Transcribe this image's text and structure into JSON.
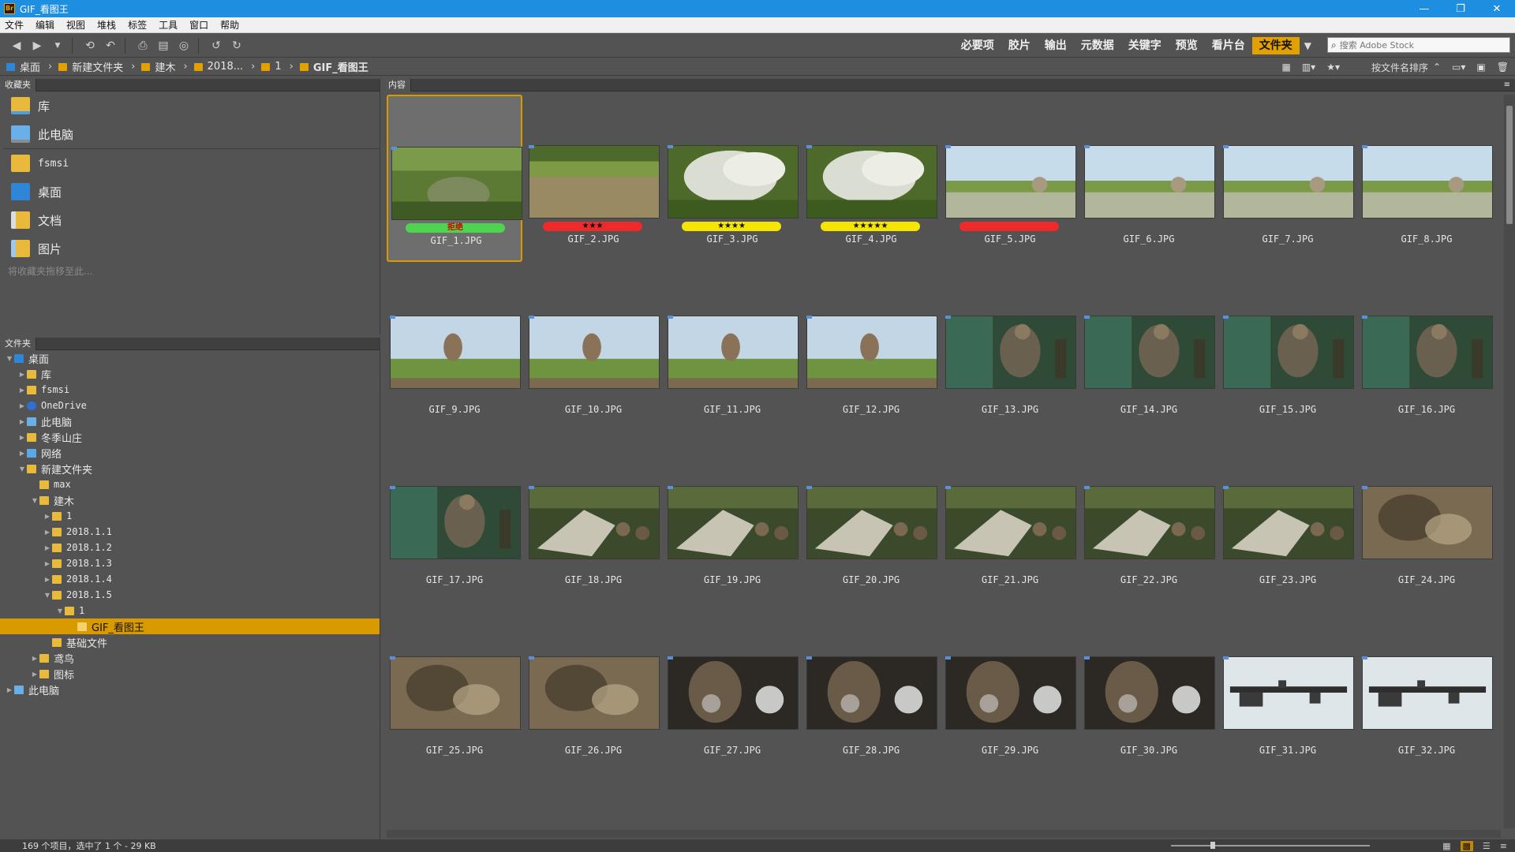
{
  "window": {
    "title": "GIF_看图王",
    "controls": [
      "—",
      "❐",
      "✕"
    ]
  },
  "menu": [
    "文件",
    "编辑",
    "视图",
    "堆栈",
    "标签",
    "工具",
    "窗口",
    "帮助"
  ],
  "toolbar": {
    "workspaces": [
      "必要项",
      "胶片",
      "输出",
      "元数据",
      "关键字",
      "预览",
      "看片台",
      "文件夹"
    ],
    "active_workspace": "文件夹",
    "search_placeholder": "搜索 Adobe Stock"
  },
  "breadcrumb": [
    "桌面",
    "新建文件夹",
    "建木",
    "2018...",
    "1",
    "GIF_看图王"
  ],
  "path_tools": {
    "sort_label": "按文件名排序"
  },
  "favorites": {
    "tab": "收藏夹",
    "items": [
      {
        "label": "库",
        "icon": "library-folder-icon"
      },
      {
        "label": "此电脑",
        "icon": "computer-icon"
      },
      {
        "label": "fsmsi",
        "icon": "user-folder-icon"
      },
      {
        "label": "桌面",
        "icon": "desktop-icon"
      },
      {
        "label": "文档",
        "icon": "documents-folder-icon"
      },
      {
        "label": "图片",
        "icon": "pictures-folder-icon"
      }
    ],
    "hint": "将收藏夹拖移至此..."
  },
  "folders": {
    "tab": "文件夹",
    "tree": [
      {
        "label": "桌面",
        "level": 0,
        "icon": "blue",
        "open": true
      },
      {
        "label": "库",
        "level": 1,
        "icon": "folder",
        "open": false
      },
      {
        "label": "fsmsi",
        "level": 1,
        "icon": "folder",
        "open": false
      },
      {
        "label": "OneDrive",
        "level": 1,
        "icon": "cloud",
        "open": false
      },
      {
        "label": "此电脑",
        "level": 1,
        "icon": "pc",
        "open": false
      },
      {
        "label": "冬季山庄",
        "level": 1,
        "icon": "folder",
        "open": false
      },
      {
        "label": "网络",
        "level": 1,
        "icon": "net",
        "open": false
      },
      {
        "label": "新建文件夹",
        "level": 1,
        "icon": "folder",
        "open": true
      },
      {
        "label": "max",
        "level": 2,
        "icon": "folder",
        "open": null
      },
      {
        "label": "建木",
        "level": 2,
        "icon": "folder",
        "open": true
      },
      {
        "label": "1",
        "level": 3,
        "icon": "folder",
        "open": false
      },
      {
        "label": "2018.1.1",
        "level": 3,
        "icon": "folder",
        "open": false
      },
      {
        "label": "2018.1.2",
        "level": 3,
        "icon": "folder",
        "open": false
      },
      {
        "label": "2018.1.3",
        "level": 3,
        "icon": "folder",
        "open": false
      },
      {
        "label": "2018.1.4",
        "level": 3,
        "icon": "folder",
        "open": false
      },
      {
        "label": "2018.1.5",
        "level": 3,
        "icon": "folder",
        "open": true
      },
      {
        "label": "1",
        "level": 4,
        "icon": "folder",
        "open": true
      },
      {
        "label": "GIF_看图王",
        "level": 5,
        "icon": "folder",
        "open": null,
        "selected": true
      },
      {
        "label": "基础文件",
        "level": 3,
        "icon": "folder",
        "open": null
      },
      {
        "label": "鸢鸟",
        "level": 2,
        "icon": "folder",
        "open": false
      },
      {
        "label": "图标",
        "level": 2,
        "icon": "folder",
        "open": false
      },
      {
        "label": "此电脑",
        "level": 0,
        "icon": "pc",
        "open": false
      }
    ]
  },
  "content": {
    "tab": "内容",
    "files": [
      {
        "name": "GIF_1.JPG",
        "scene": "grass",
        "label": "green",
        "label_text": "拒绝",
        "selected": true
      },
      {
        "name": "GIF_2.JPG",
        "scene": "field",
        "label": "red",
        "label_text": "★★★"
      },
      {
        "name": "GIF_3.JPG",
        "scene": "smoke",
        "label": "yellow",
        "label_text": "★★★★"
      },
      {
        "name": "GIF_4.JPG",
        "scene": "smoke",
        "label": "yellow",
        "label_text": "★★★★★"
      },
      {
        "name": "GIF_5.JPG",
        "scene": "sky",
        "label": "red",
        "label_text": ""
      },
      {
        "name": "GIF_6.JPG",
        "scene": "sky"
      },
      {
        "name": "GIF_7.JPG",
        "scene": "sky"
      },
      {
        "name": "GIF_8.JPG",
        "scene": "sky"
      },
      {
        "name": "GIF_9.JPG",
        "scene": "blast"
      },
      {
        "name": "GIF_10.JPG",
        "scene": "blast"
      },
      {
        "name": "GIF_11.JPG",
        "scene": "blast"
      },
      {
        "name": "GIF_12.JPG",
        "scene": "blast"
      },
      {
        "name": "GIF_13.JPG",
        "scene": "soldier"
      },
      {
        "name": "GIF_14.JPG",
        "scene": "soldier"
      },
      {
        "name": "GIF_15.JPG",
        "scene": "soldier"
      },
      {
        "name": "GIF_16.JPG",
        "scene": "soldier"
      },
      {
        "name": "GIF_17.JPG",
        "scene": "soldier"
      },
      {
        "name": "GIF_18.JPG",
        "scene": "group"
      },
      {
        "name": "GIF_19.JPG",
        "scene": "group"
      },
      {
        "name": "GIF_20.JPG",
        "scene": "group"
      },
      {
        "name": "GIF_21.JPG",
        "scene": "group"
      },
      {
        "name": "GIF_22.JPG",
        "scene": "group"
      },
      {
        "name": "GIF_23.JPG",
        "scene": "group"
      },
      {
        "name": "GIF_24.JPG",
        "scene": "blur"
      },
      {
        "name": "GIF_25.JPG",
        "scene": "blur"
      },
      {
        "name": "GIF_26.JPG",
        "scene": "blur"
      },
      {
        "name": "GIF_27.JPG",
        "scene": "face"
      },
      {
        "name": "GIF_28.JPG",
        "scene": "face"
      },
      {
        "name": "GIF_29.JPG",
        "scene": "face"
      },
      {
        "name": "GIF_30.JPG",
        "scene": "face"
      },
      {
        "name": "GIF_31.JPG",
        "scene": "gun"
      },
      {
        "name": "GIF_32.JPG",
        "scene": "gun"
      }
    ]
  },
  "status": {
    "text": "169 个项目，选中了 1 个 - 29 KB"
  },
  "colors": {
    "accent": "#d99a00",
    "panel": "#535353",
    "titlebar": "#1e8ee0"
  }
}
